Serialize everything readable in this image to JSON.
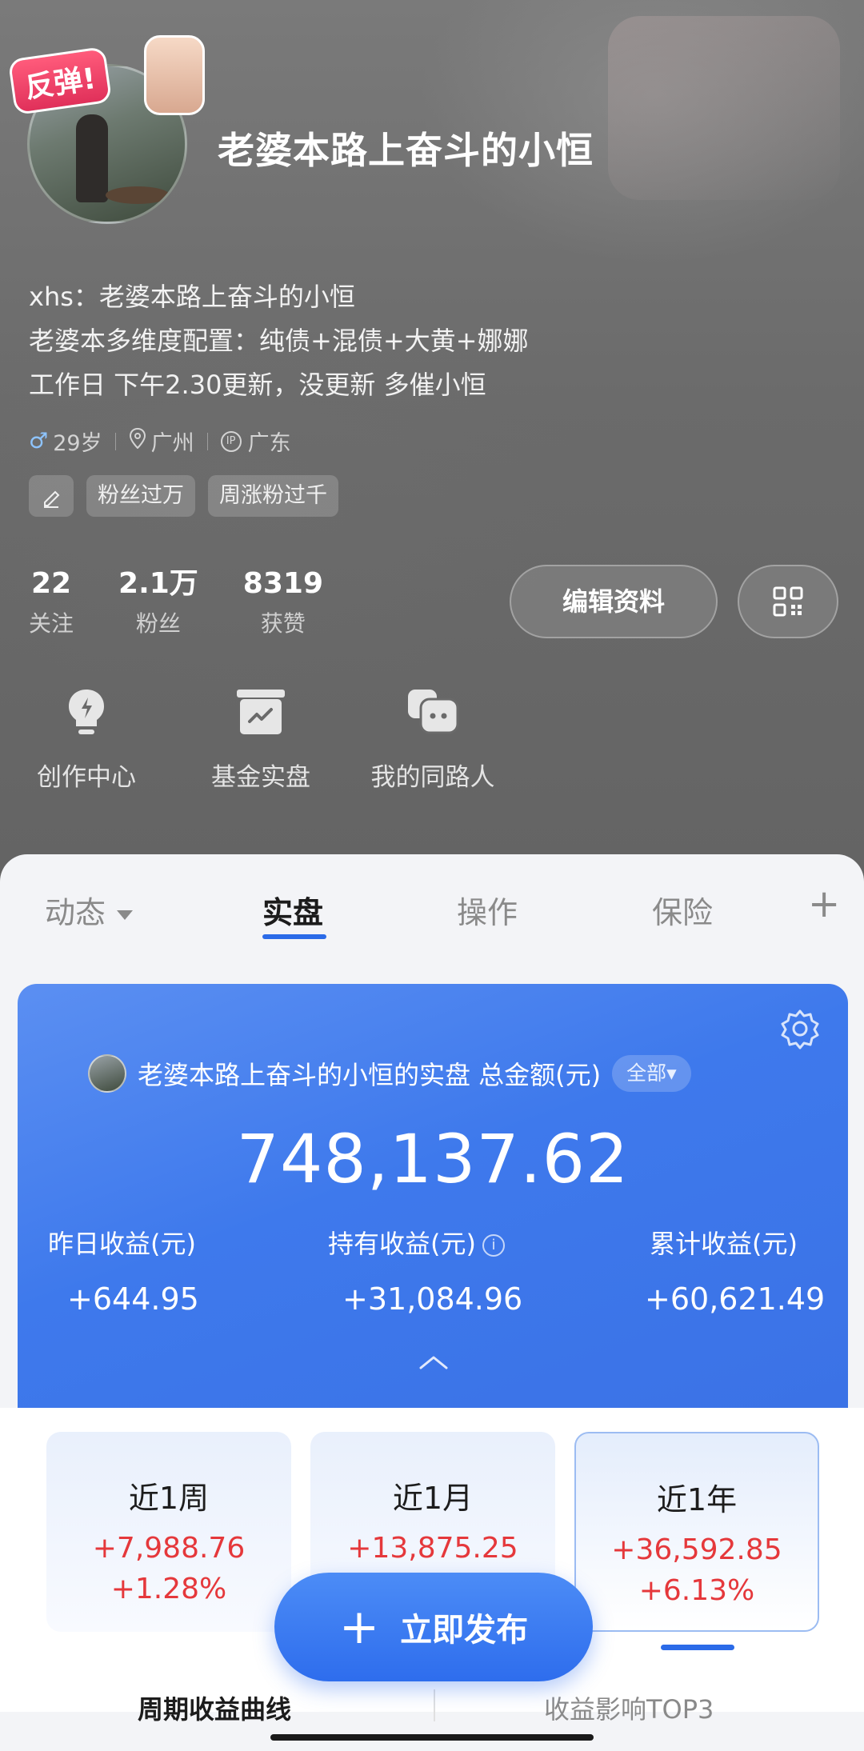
{
  "profile": {
    "nickname": "老婆本路上奋斗的小恒",
    "avatar_badge": "反弹!",
    "bio": [
      "xhs：老婆本路上奋斗的小恒",
      "老婆本多维度配置：纯债+混债+大黄+娜娜",
      "工作日 下午2.30更新，没更新 多催小恒"
    ],
    "gender_symbol": "♂",
    "age": "29岁",
    "city": "广州",
    "ip_label": "IP",
    "ip_location": "广东",
    "tags": [
      "粉丝过万",
      "周涨粉过千"
    ]
  },
  "stats": [
    {
      "value": "22",
      "label": "关注"
    },
    {
      "value": "2.1万",
      "label": "粉丝"
    },
    {
      "value": "8319",
      "label": "获赞"
    }
  ],
  "buttons": {
    "edit_profile": "编辑资料"
  },
  "shortcuts": [
    {
      "label": "创作中心",
      "icon": "lightbulb-icon"
    },
    {
      "label": "基金实盘",
      "icon": "chart-box-icon"
    },
    {
      "label": "我的同路人",
      "icon": "chat-bubbles-icon"
    }
  ],
  "tabs": [
    {
      "label": "动态"
    },
    {
      "label": "实盘"
    },
    {
      "label": "操作"
    },
    {
      "label": "保险"
    }
  ],
  "tab_plus": "+",
  "portfolio": {
    "title": "老婆本路上奋斗的小恒的实盘 总金额(元)",
    "filter": "全部▾",
    "total": "748,137.62",
    "metrics": [
      {
        "label": "昨日收益(元)",
        "value": "+644.95"
      },
      {
        "label": "持有收益(元)",
        "value": "+31,084.96"
      },
      {
        "label": "累计收益(元)",
        "value": "+60,621.49"
      }
    ]
  },
  "periods": [
    {
      "name": "近1周",
      "amount": "+7,988.76",
      "percent": "+1.28%"
    },
    {
      "name": "近1月",
      "amount": "+13,875.25",
      "percent": ""
    },
    {
      "name": "近1年",
      "amount": "+36,592.85",
      "percent": "+6.13%"
    }
  ],
  "bottom_tabs": [
    "周期收益曲线",
    "收益影响TOP3"
  ],
  "fab": {
    "plus": "+",
    "label": "立即发布"
  },
  "colors": {
    "accent": "#2b6be8",
    "gain": "#e5383b",
    "card": "#3e79ec"
  }
}
